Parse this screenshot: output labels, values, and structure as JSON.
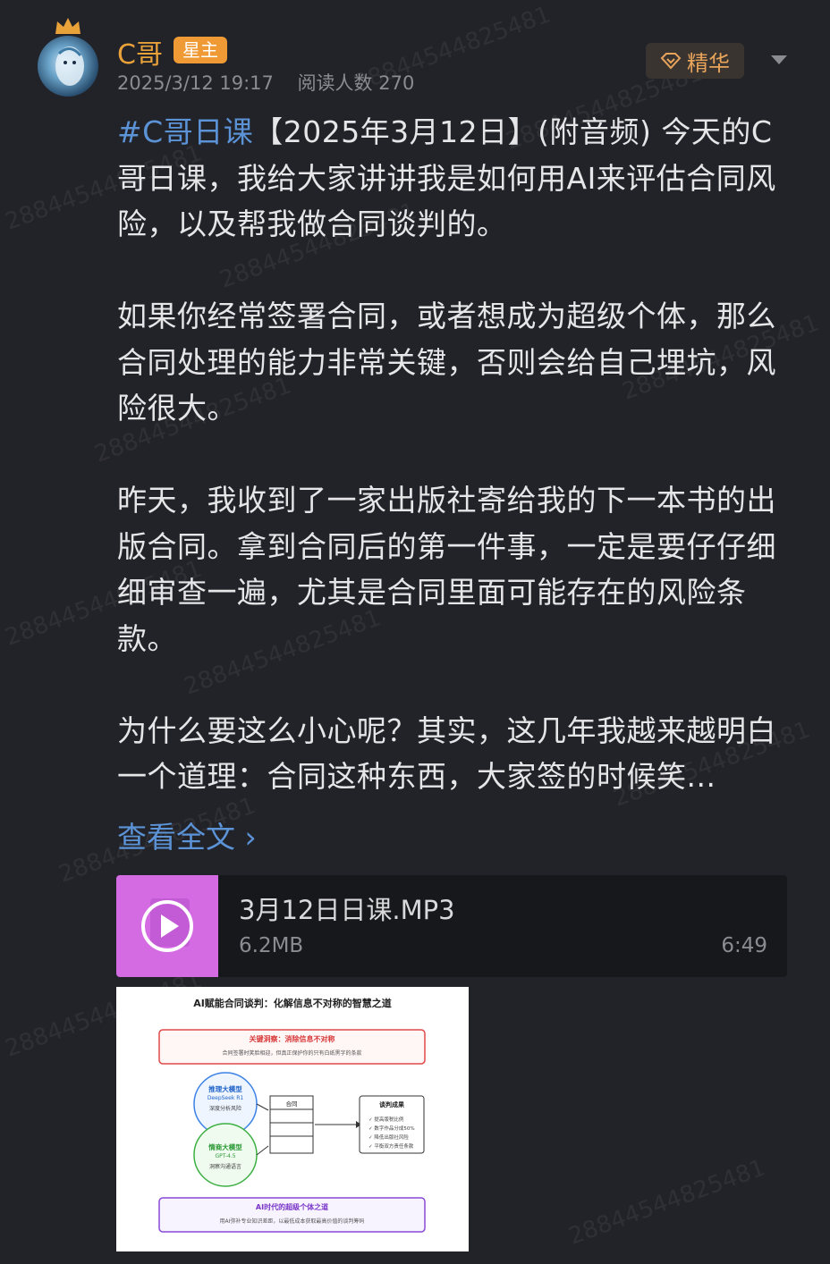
{
  "post": {
    "author": "C哥",
    "badge": "星主",
    "date": "2025/3/12 19:17",
    "read_count": "阅读人数 270",
    "essence_label": "精华",
    "hashtag": "#C哥日课",
    "p1_rest": "【2025年3月12日】(附音频) 今天的C哥日课，我给大家讲讲我是如何用AI来评估合同风险，以及帮我做合同谈判的。",
    "p2": "如果你经常签署合同，或者想成为超级个体，那么合同处理的能力非常关键，否则会给自己埋坑，风险很大。",
    "p3": "昨天，我收到了一家出版社寄给我的下一本书的出版合同。拿到合同后的第一件事，一定是要仔仔细细审查一遍，尤其是合同里面可能存在的风险条款。",
    "p4": "为什么要这么小心呢？其实，这几年我越来越明白一个道理：合同这种东西，大家签的时候笑...",
    "read_more": "查看全文 ›"
  },
  "attachment": {
    "title": "3月12日日课.MP3",
    "size": "6.2MB",
    "duration": "6:49",
    "thumb_color": "#d46be3"
  },
  "image": {
    "title": "AI赋能合同谈判：化解信息不对称的智慧之道",
    "box1_title": "关键洞察：消除信息不对称",
    "box1_text": "合同签署时笑脸相迎，但真正保护你的只有白纸黑字的条款",
    "c1_title": "推理大模型",
    "c1_sub": "DeepSeek R1",
    "c1_desc": "深度分析风险",
    "c2_title": "情商大模型",
    "c2_sub": "GPT-4.5",
    "c2_desc": "洞察沟通语言",
    "doc_label": "合同",
    "res_title": "谈判成果",
    "res_items": [
      "✓ 提高版税比例",
      "✓ 数字作品分成50%",
      "✓ 降低出版社风险",
      "✓ 平衡双方责任条款"
    ],
    "box3_title": "AI时代的超级个体之道",
    "box3_text": "用AI弥补专业知识差距，以最低成本获取最高价值的谈判筹码"
  },
  "watermark": "28844544825481",
  "colors": {
    "background": "#222328",
    "author": "#e9a23a",
    "badge": "#f09a36",
    "link": "#5b93d6",
    "essence_text": "#e8a45a"
  }
}
